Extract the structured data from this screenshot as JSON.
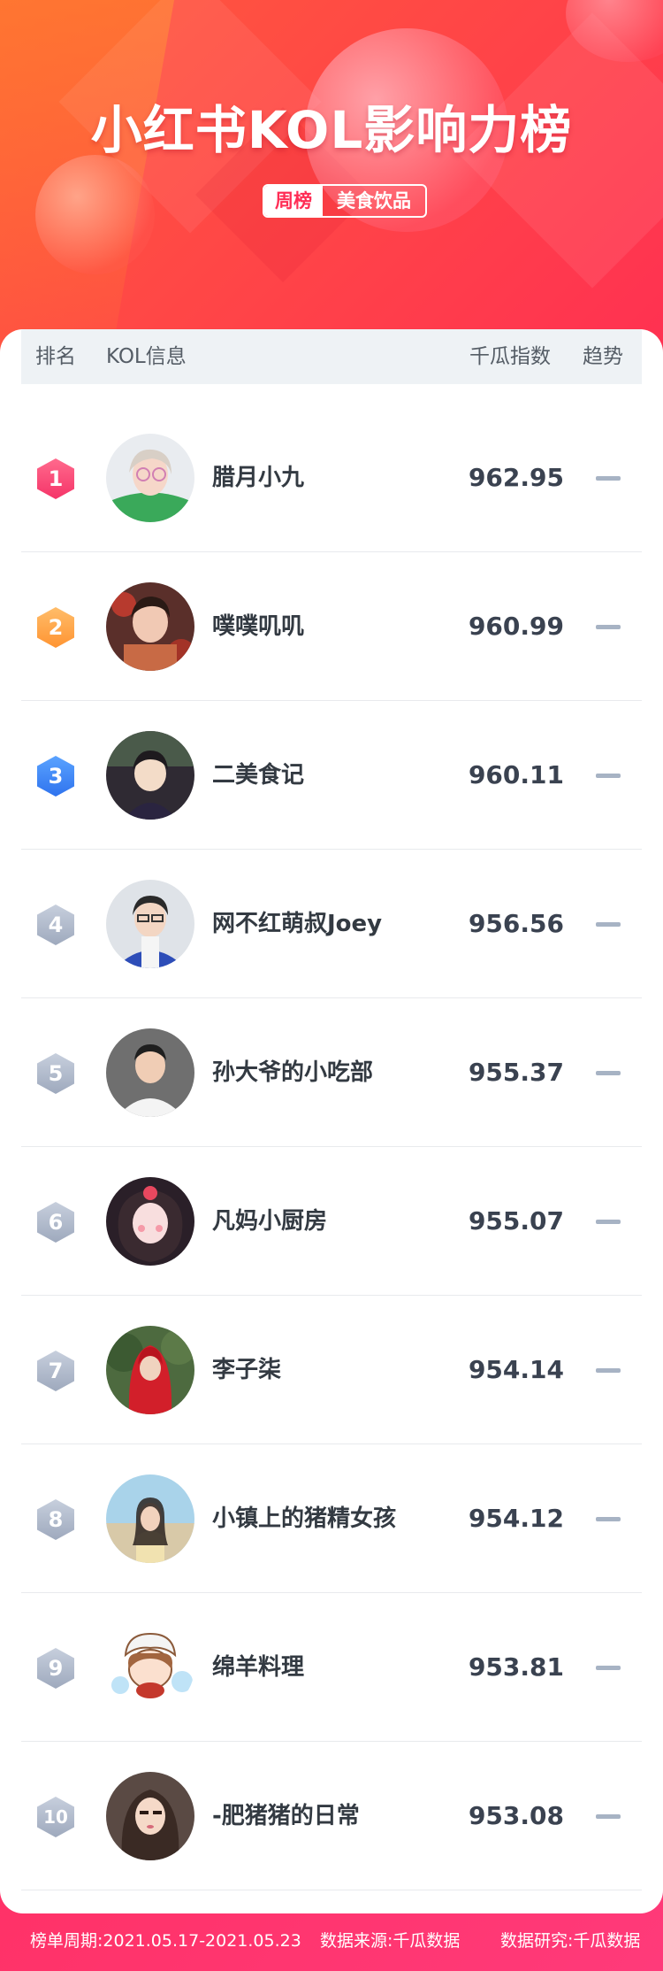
{
  "header": {
    "title": "小红书KOL影响力榜",
    "tag_period": "周榜",
    "tag_category": "美食饮品"
  },
  "table": {
    "col_rank": "排名",
    "col_info": "KOL信息",
    "col_index": "千瓜指数",
    "col_trend": "趋势",
    "rows": [
      {
        "rank": "1",
        "name": "腊月小九",
        "score": "962.95",
        "trend": "flat"
      },
      {
        "rank": "2",
        "name": "噗噗叽叽",
        "score": "960.99",
        "trend": "flat"
      },
      {
        "rank": "3",
        "name": "二美食记",
        "score": "960.11",
        "trend": "flat"
      },
      {
        "rank": "4",
        "name": "网不红萌叔Joey",
        "score": "956.56",
        "trend": "flat"
      },
      {
        "rank": "5",
        "name": "孙大爷的小吃部",
        "score": "955.37",
        "trend": "flat"
      },
      {
        "rank": "6",
        "name": "凡妈小厨房",
        "score": "955.07",
        "trend": "flat"
      },
      {
        "rank": "7",
        "name": "李子柒",
        "score": "954.14",
        "trend": "flat"
      },
      {
        "rank": "8",
        "name": "小镇上的猪精女孩",
        "score": "954.12",
        "trend": "flat"
      },
      {
        "rank": "9",
        "name": "绵羊料理",
        "score": "953.81",
        "trend": "flat"
      },
      {
        "rank": "10",
        "name": "-肥猪猪的日常",
        "score": "953.08",
        "trend": "flat"
      }
    ]
  },
  "footer": {
    "period": "榜单周期:2021.05.17-2021.05.23",
    "source": "数据来源:千瓜数据",
    "research": "数据研究:千瓜数据"
  },
  "colors": {
    "brand_red": "#ff2d55",
    "rank1": "#f53468",
    "rank2": "#ff9432",
    "rank3": "#2f73ee",
    "rank_other": "#9ea9bd"
  }
}
